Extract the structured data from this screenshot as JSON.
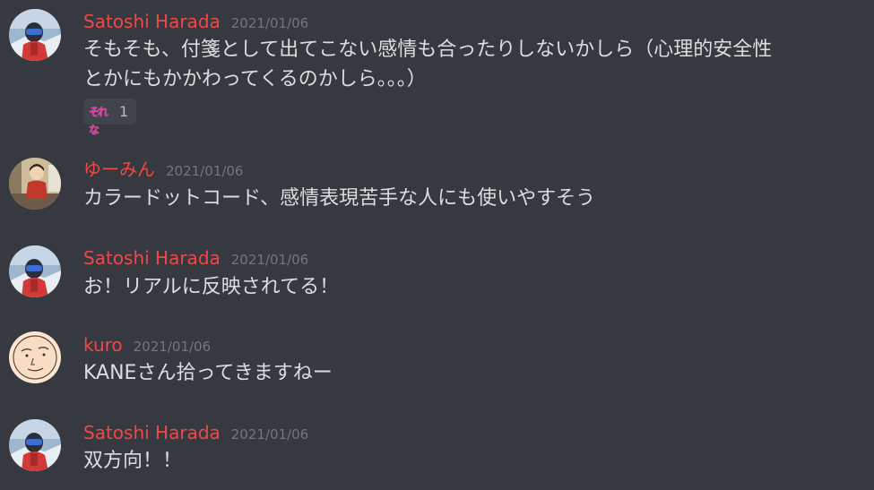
{
  "messages": [
    {
      "author": "Satoshi Harada",
      "timestamp": "2021/01/06",
      "avatar_icon": "ski-person-avatar",
      "lines": [
        "そもそも、付箋として出てこない感情も合ったりしないかしら（心理的安全性",
        "とかにもかかわってくるのかしら。。。）"
      ],
      "reaction": {
        "emoji": "それな",
        "emoji_icon": "sorena-emoji",
        "count": "1"
      }
    },
    {
      "author": "ゆーみん",
      "timestamp": "2021/01/06",
      "avatar_icon": "photo-person-avatar",
      "lines": [
        "カラードットコード、感情表現苦手な人にも使いやすそう"
      ]
    },
    {
      "author": "Satoshi Harada",
      "timestamp": "2021/01/06",
      "avatar_icon": "ski-person-avatar",
      "lines": [
        "お！リアルに反映されてる！"
      ]
    },
    {
      "author": "kuro",
      "timestamp": "2021/01/06",
      "avatar_icon": "drawn-face-avatar",
      "lines": [
        "KANEさん拾ってきますねー"
      ]
    },
    {
      "author": "Satoshi Harada",
      "timestamp": "2021/01/06",
      "avatar_icon": "ski-person-avatar",
      "lines": [
        "双方向！！"
      ]
    }
  ],
  "colors": {
    "background": "#36393f",
    "author": "#f04747",
    "timestamp": "#72767d",
    "message_text": "#dcddde",
    "reaction_bg": "#40444b"
  }
}
